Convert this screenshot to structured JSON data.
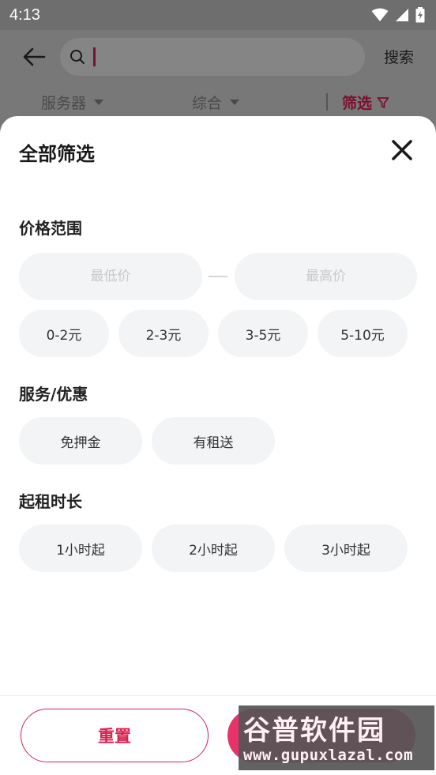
{
  "status_bar": {
    "time": "4:13"
  },
  "search": {
    "placeholder": "",
    "button_label": "搜索"
  },
  "tabs": [
    {
      "label": "服务器"
    },
    {
      "label": "综合"
    },
    {
      "label": "筛选"
    }
  ],
  "sheet": {
    "title": "全部筛选",
    "price_section": {
      "title": "价格范围",
      "min_placeholder": "最低价",
      "max_placeholder": "最高价",
      "chips": [
        "0-2元",
        "2-3元",
        "3-5元",
        "5-10元"
      ]
    },
    "service_section": {
      "title": "服务/优惠",
      "chips": [
        "免押金",
        "有租送"
      ]
    },
    "duration_section": {
      "title": "起租时长",
      "chips": [
        "1小时起",
        "2小时起",
        "3小时起"
      ]
    },
    "footer": {
      "reset_label": "重置"
    }
  },
  "watermark": {
    "logo_text": "谷普软件园",
    "url": "www.gupuxlazal.com"
  },
  "colors": {
    "accent": "#d8224f",
    "chip_bg": "#f2f4f5",
    "overlay": "#787878"
  }
}
